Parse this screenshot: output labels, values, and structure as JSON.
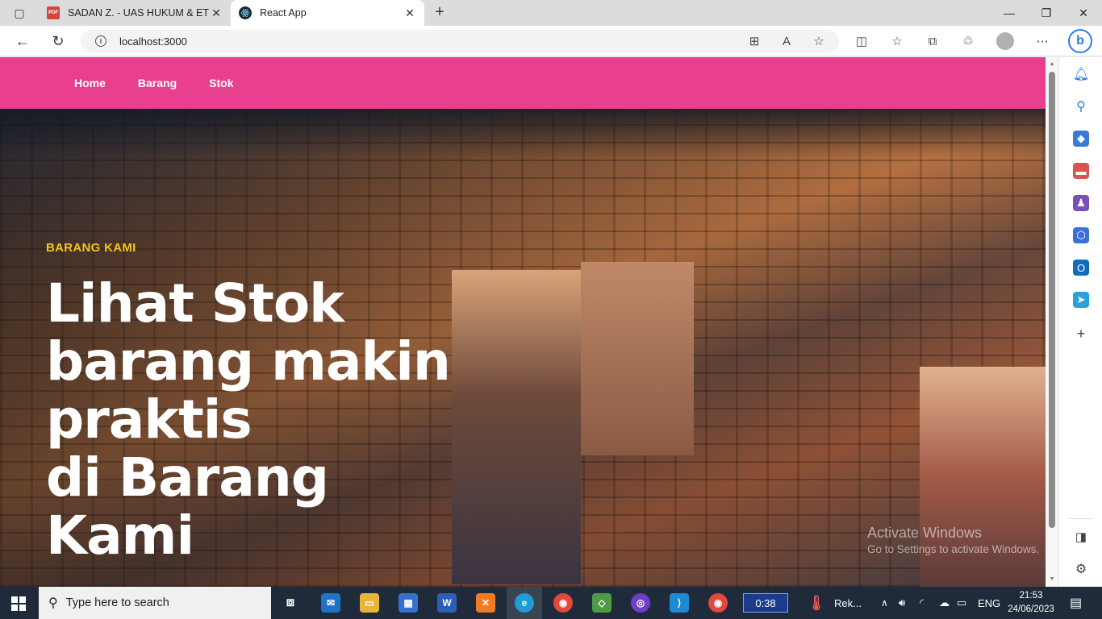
{
  "browser": {
    "tabs": [
      {
        "title": "SADAN Z. - UAS HUKUM & ETIKA",
        "favicon": "pdf-icon",
        "active": false
      },
      {
        "title": "React App",
        "favicon": "react-icon",
        "active": true
      }
    ],
    "url": "localhost:3000"
  },
  "navbar": {
    "items": [
      {
        "label": "Home"
      },
      {
        "label": "Barang"
      },
      {
        "label": "Stok"
      }
    ],
    "color": "#e8408f"
  },
  "hero": {
    "subtitle": "BARANG KAMI",
    "title_lines": [
      "Lihat Stok",
      "barang makin",
      "praktis",
      "di Barang",
      "Kami"
    ],
    "subtitle_color": "#f5c518"
  },
  "watermark": {
    "line1": "Activate Windows",
    "line2": "Go to Settings to activate Windows."
  },
  "taskbar": {
    "search_placeholder": "Type here to search",
    "timer": "0:38",
    "rek_label": "Rek...",
    "language": "ENG",
    "time": "21:53",
    "date": "24/06/2023"
  }
}
